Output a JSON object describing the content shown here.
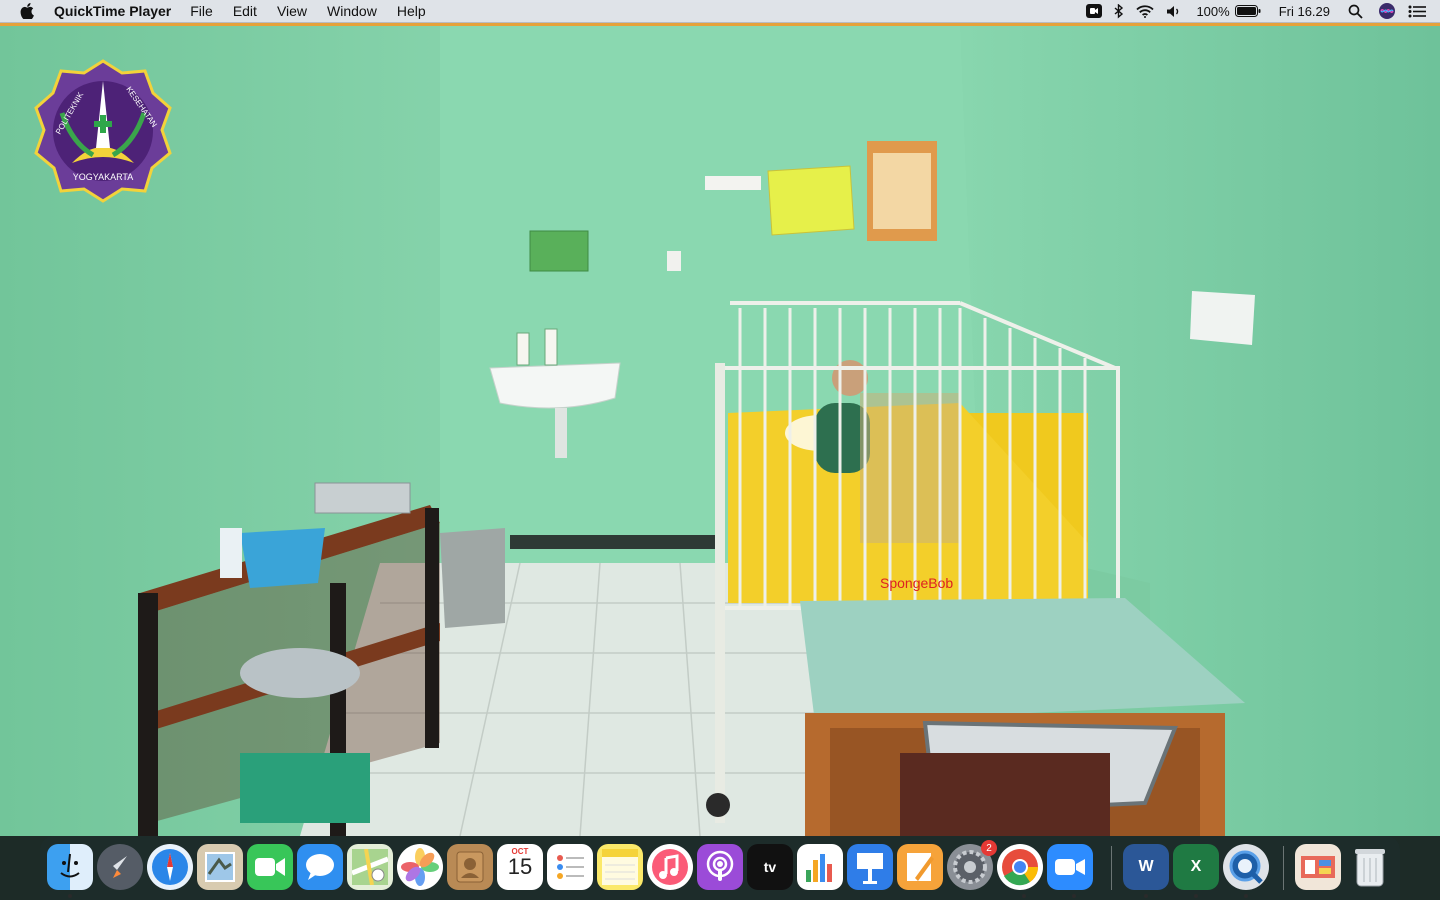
{
  "menubar": {
    "app_name": "QuickTime Player",
    "items": [
      "File",
      "Edit",
      "View",
      "Window",
      "Help"
    ],
    "battery": "100%",
    "clock": "Fri 16.29"
  },
  "video": {
    "logo_text_left": "POLITEKNIK",
    "logo_text_right": "KESEHATAN",
    "logo_text_bottom": "YOGYAKARTA",
    "mattress_print": "SpongeBob"
  },
  "dock": {
    "calendar_month": "OCT",
    "calendar_day": "15",
    "system_prefs_badge": "2",
    "tv_label": "tv",
    "word_letter": "W",
    "excel_letter": "X"
  },
  "colors": {
    "accent": "#e5a23a",
    "wall": "#7ccba2",
    "menubar": "#dfe3e8"
  }
}
